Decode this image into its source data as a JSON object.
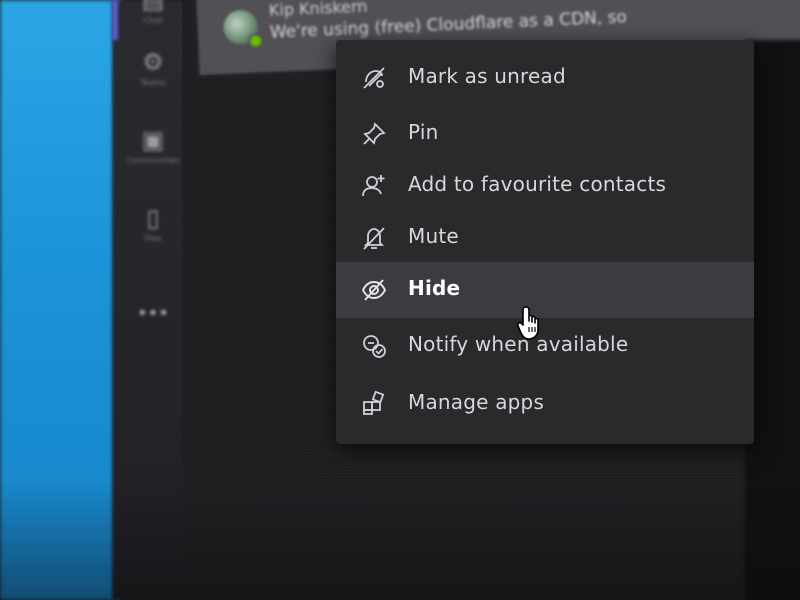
{
  "rail": {
    "items": [
      {
        "label": "Chat",
        "icon": "chat-icon"
      },
      {
        "label": "Teams",
        "icon": "teams-icon"
      },
      {
        "label": "Communities",
        "icon": "communities-icon"
      },
      {
        "label": "Files",
        "icon": "files-icon"
      },
      {
        "label": "•••",
        "icon": "more-icon"
      }
    ]
  },
  "chat_header": {
    "contact_name": "Kip Kniskern",
    "message_preview": "We're using (free) Cloudflare as a CDN, so",
    "status_color": "#6bb700"
  },
  "context_menu": {
    "items": [
      {
        "label": "Mark as unread",
        "icon": "mark-unread-icon"
      },
      {
        "label": "Pin",
        "icon": "pin-icon"
      },
      {
        "label": "Add to favourite contacts",
        "icon": "add-contact-icon"
      },
      {
        "label": "Mute",
        "icon": "mute-bell-icon"
      },
      {
        "label": "Hide",
        "icon": "hide-eye-icon",
        "hovered": true
      },
      {
        "label": "Notify when available",
        "icon": "notify-available-icon"
      },
      {
        "label": "Manage apps",
        "icon": "apps-icon"
      }
    ]
  },
  "colors": {
    "accent": "#5b5fc7",
    "menu_background": "#2a2a2d",
    "menu_hover": "#3c3c40",
    "desktop_blue": "#1c93d8"
  }
}
